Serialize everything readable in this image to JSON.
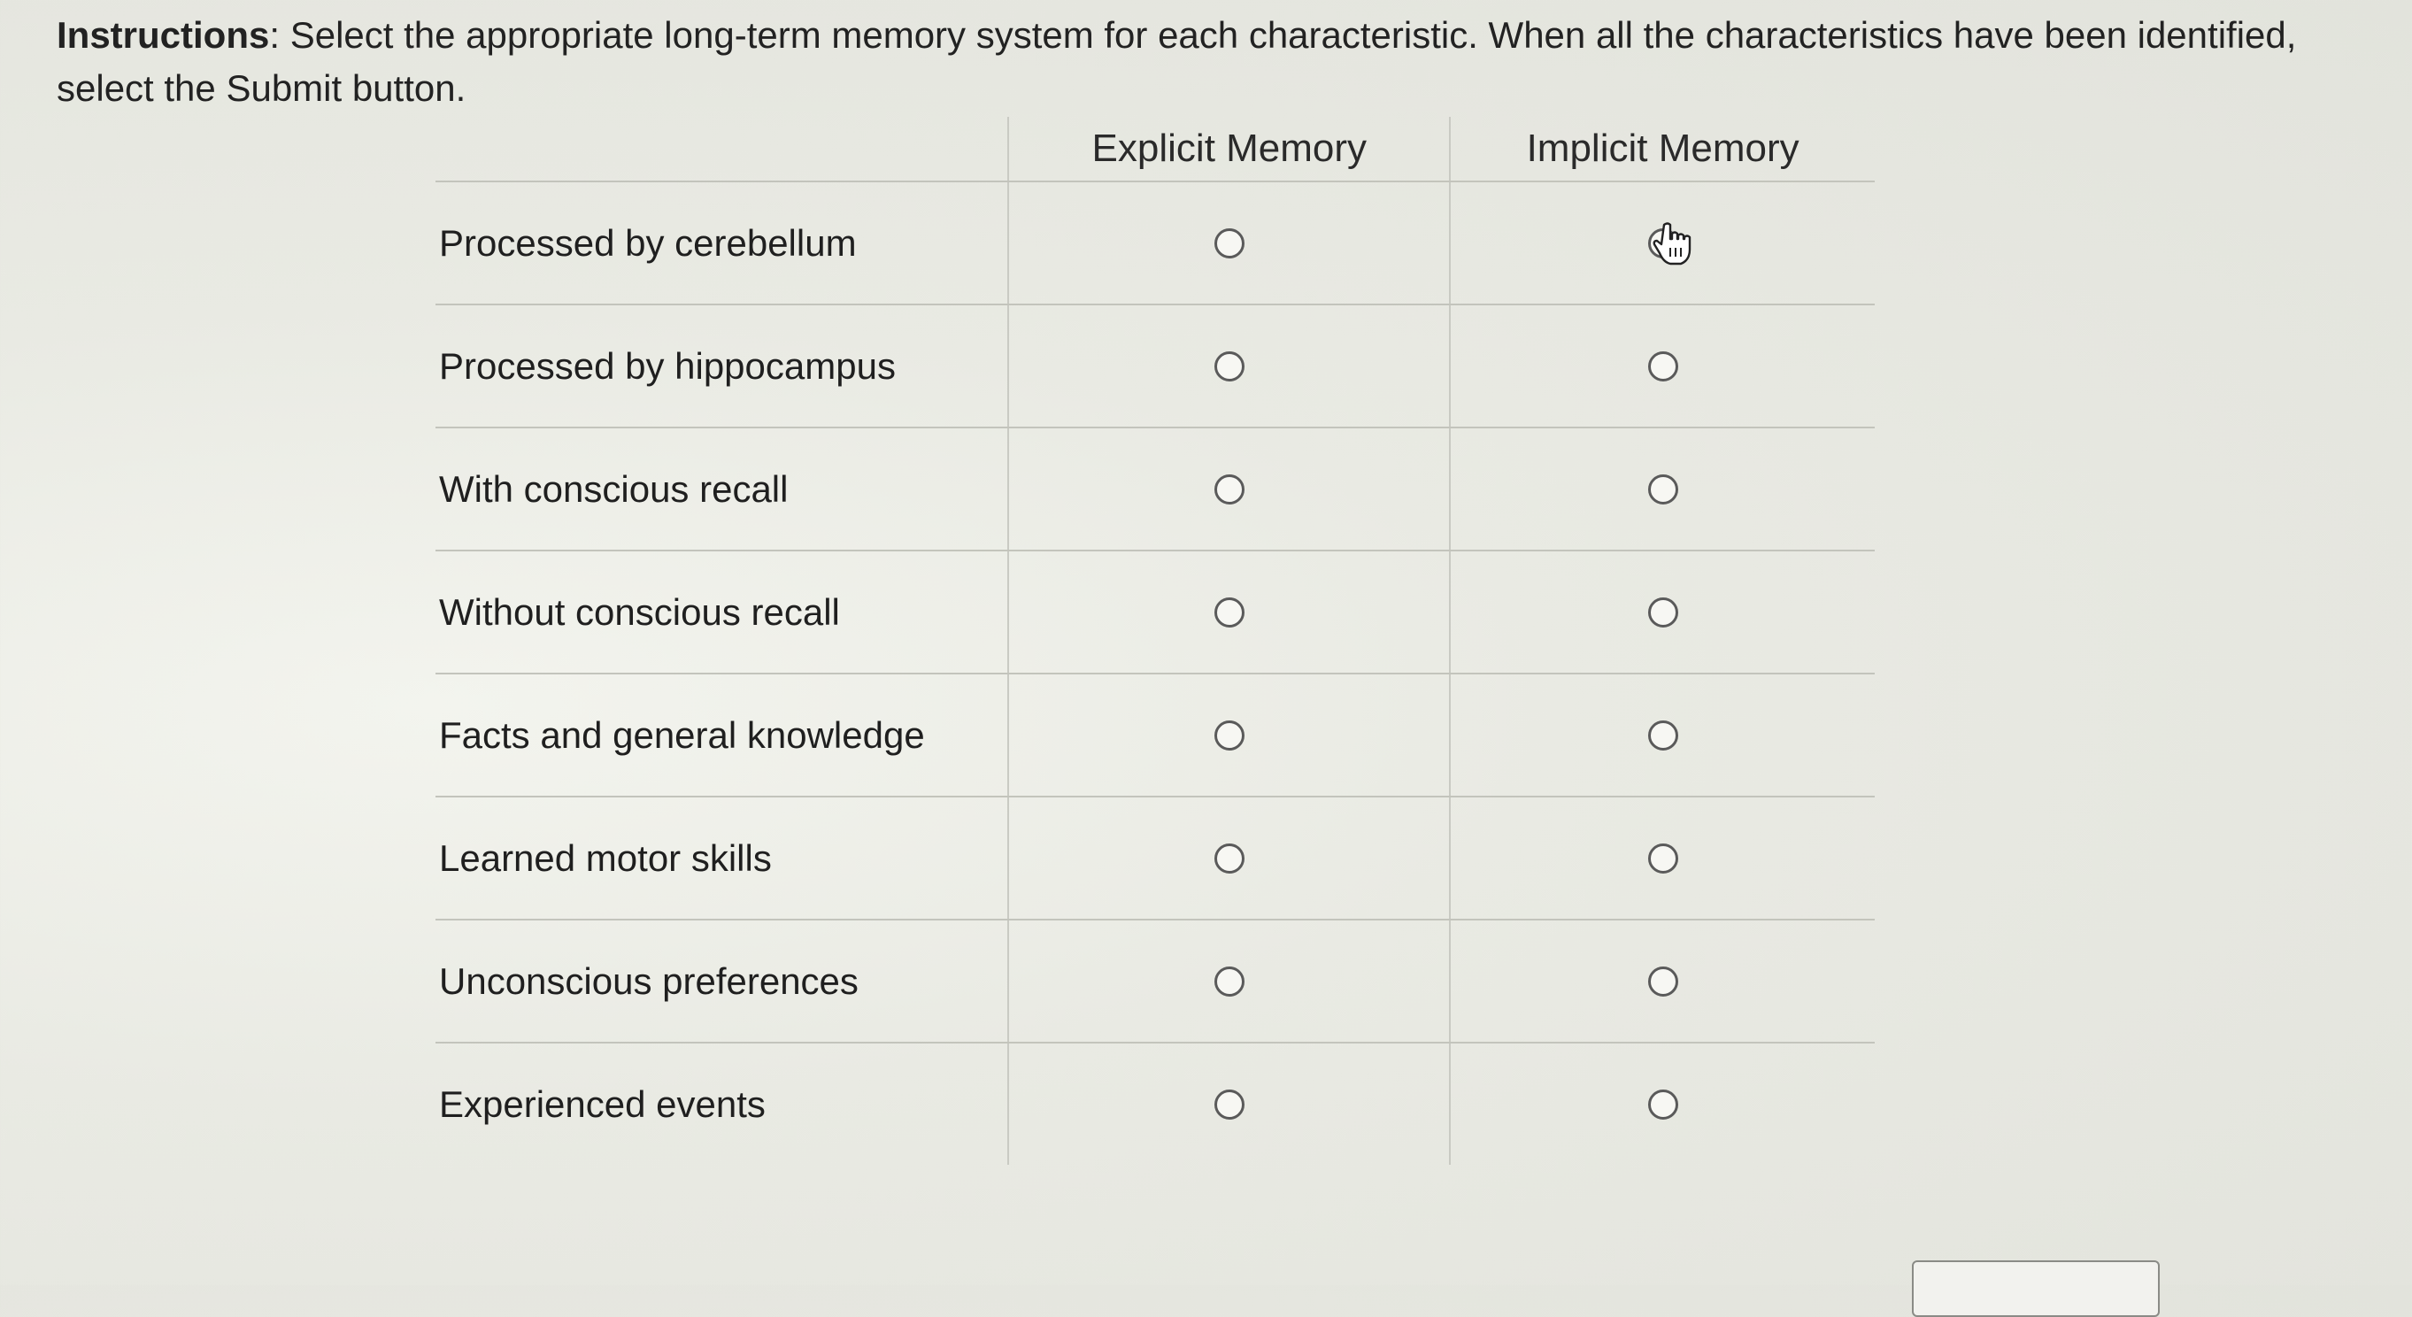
{
  "instructions": {
    "bold_label": "Instructions",
    "text": ": Select the appropriate long-term memory system for each characteristic. When all the characteristics have been identified, select the Submit button."
  },
  "columns": [
    "Explicit Memory",
    "Implicit Memory"
  ],
  "rows": [
    {
      "label": "Processed by cerebellum"
    },
    {
      "label": "Processed by hippocampus"
    },
    {
      "label": "With conscious recall"
    },
    {
      "label": "Without conscious recall"
    },
    {
      "label": "Facts and general knowledge"
    },
    {
      "label": "Learned motor skills"
    },
    {
      "label": "Unconscious preferences"
    },
    {
      "label": "Experienced events"
    }
  ],
  "icons": {
    "radio": "radio-button-icon",
    "cursor": "hand-pointer-icon"
  }
}
